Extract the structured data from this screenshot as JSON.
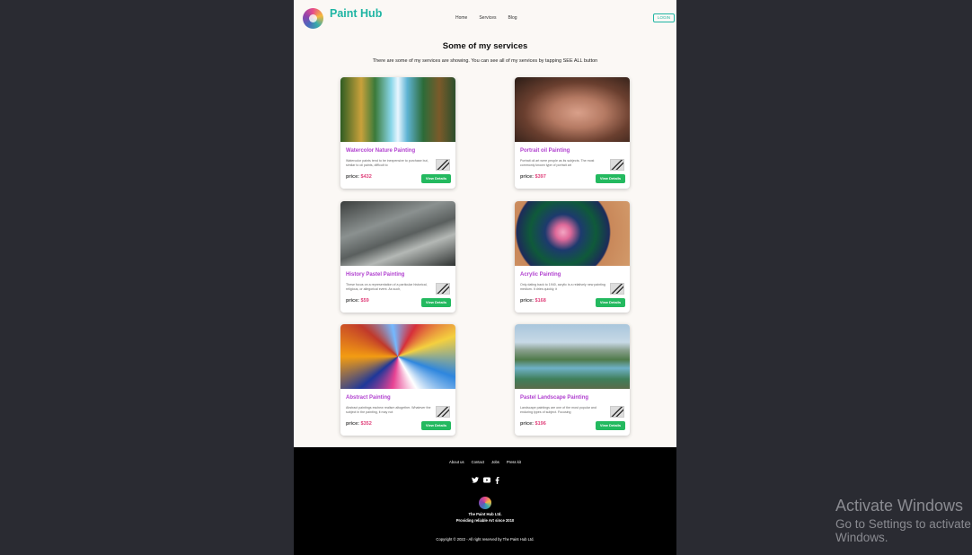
{
  "brand": {
    "name": "Paint Hub"
  },
  "nav": {
    "items": [
      "Home",
      "Services",
      "Blog"
    ],
    "login": "LOGIN"
  },
  "section": {
    "title": "Some of my services",
    "subtitle": "There are some of my services are showing. You can see all of my services by tapping SEE ALL button"
  },
  "cards": [
    {
      "title": "Watercolor Nature Painting",
      "desc": "Watercolor paints tend to be inexpensive to purchase but, similar to oil paints, difficult to",
      "price_label": "price:",
      "price": "$432",
      "button": "View Details"
    },
    {
      "title": "Portrait oil Painting",
      "desc": "Portrait oil art were people as its subjects. The most commonly known type of portrait art",
      "price_label": "price:",
      "price": "$397",
      "button": "View Details"
    },
    {
      "title": "History Pastel Painting",
      "desc": "These focus on a representation of a particular historical, religious, or allegorical event. As such,",
      "price_label": "price:",
      "price": "$59",
      "button": "View Details"
    },
    {
      "title": "Acrylic Painting",
      "desc": "Only dating back to 1940, acrylic is a relatively new painting medium. It dries quickly, it",
      "price_label": "price:",
      "price": "$168",
      "button": "View Details"
    },
    {
      "title": "Abstract Painting",
      "desc": "Abstract paintings eschew realism altogether. Whatever the subject in the painting, it may not",
      "price_label": "price:",
      "price": "$352",
      "button": "View Details"
    },
    {
      "title": "Pastel Landscape Painting",
      "desc": "Landscape paintings are one of the most popular and enduring types of subject. Focusing",
      "price_label": "price:",
      "price": "$196",
      "button": "View Details"
    }
  ],
  "footer": {
    "links": [
      "About us",
      "Contact",
      "Jobs",
      "Press kit"
    ],
    "socials": [
      "twitter-icon",
      "youtube-icon",
      "facebook-icon"
    ],
    "company": "The Paint Hub Ltd.",
    "tagline": "Providing reliable Art since 2010",
    "copyright": "Copyright © 2022 - All right reserved by The Paint Hub Ltd."
  },
  "watermark": {
    "line1": "Activate Windows",
    "line2": "Go to Settings to activate Windows."
  }
}
